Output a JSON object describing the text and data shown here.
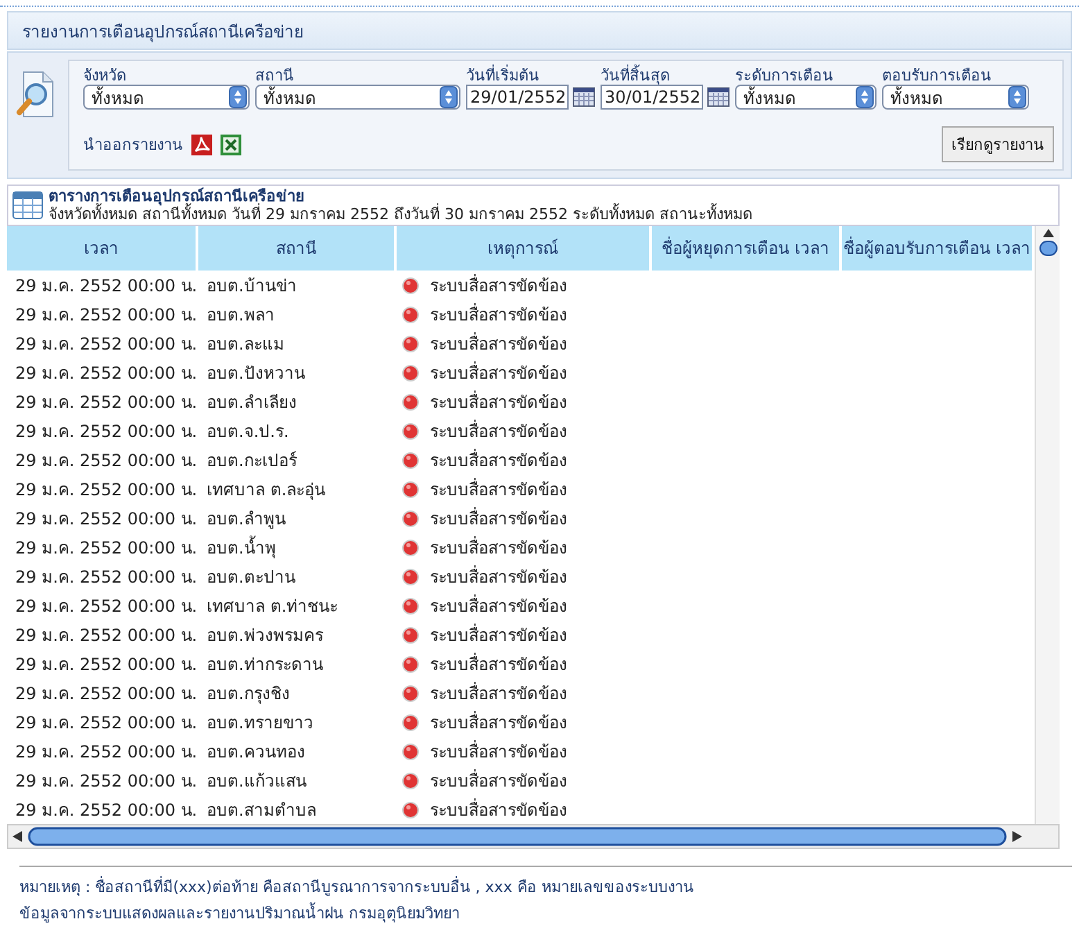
{
  "title": "รายงานการเตือนอุปกรณ์สถานีเครือข่าย",
  "filters": [
    {
      "kind": "select",
      "label": "จังหวัด",
      "value": "ทั้งหมด"
    },
    {
      "kind": "select",
      "label": "สถานี",
      "value": "ทั้งหมด"
    },
    {
      "kind": "date",
      "label": "วันที่เริ่มต้น",
      "value": "29/01/2552"
    },
    {
      "kind": "date",
      "label": "วันที่สิ้นสุด",
      "value": "30/01/2552"
    },
    {
      "kind": "select",
      "label": "ระดับการเตือน",
      "value": "ทั้งหมด"
    },
    {
      "kind": "select",
      "label": "ตอบรับการเตือน",
      "value": "ทั้งหมด"
    }
  ],
  "export_label": "นำออกรายงาน",
  "view_button": "เรียกดูรายงาน",
  "table": {
    "title": "ตารางการเตือนอุปกรณ์สถานีเครือข่าย",
    "subtitle": "จังหวัดทั้งหมด สถานีทั้งหมด วันที่ 29 มกราคม 2552 ถึงวันที่ 30 มกราคม 2552 ระดับทั้งหมด สถานะทั้งหมด",
    "columns": [
      "เวลา",
      "สถานี",
      "เหตุการณ์",
      "ชื่อผู้หยุดการเตือน เวลา",
      "ชื่อผู้ตอบรับการเตือน เวลา"
    ],
    "rows": [
      {
        "time": "29 ม.ค. 2552 00:00 น.",
        "station": "อบต.บ้านข่า",
        "event": "ระบบสื่อสารขัดข้อง"
      },
      {
        "time": "29 ม.ค. 2552 00:00 น.",
        "station": "อบต.พลา",
        "event": "ระบบสื่อสารขัดข้อง"
      },
      {
        "time": "29 ม.ค. 2552 00:00 น.",
        "station": "อบต.ละแม",
        "event": "ระบบสื่อสารขัดข้อง"
      },
      {
        "time": "29 ม.ค. 2552 00:00 น.",
        "station": "อบต.ปังหวาน",
        "event": "ระบบสื่อสารขัดข้อง"
      },
      {
        "time": "29 ม.ค. 2552 00:00 น.",
        "station": "อบต.ลำเลียง",
        "event": "ระบบสื่อสารขัดข้อง"
      },
      {
        "time": "29 ม.ค. 2552 00:00 น.",
        "station": "อบต.จ.ป.ร.",
        "event": "ระบบสื่อสารขัดข้อง"
      },
      {
        "time": "29 ม.ค. 2552 00:00 น.",
        "station": "อบต.กะเปอร์",
        "event": "ระบบสื่อสารขัดข้อง"
      },
      {
        "time": "29 ม.ค. 2552 00:00 น.",
        "station": "เทศบาล ต.ละอุ่น",
        "event": "ระบบสื่อสารขัดข้อง"
      },
      {
        "time": "29 ม.ค. 2552 00:00 น.",
        "station": "อบต.ลำพูน",
        "event": "ระบบสื่อสารขัดข้อง"
      },
      {
        "time": "29 ม.ค. 2552 00:00 น.",
        "station": "อบต.น้ำพุ",
        "event": "ระบบสื่อสารขัดข้อง"
      },
      {
        "time": "29 ม.ค. 2552 00:00 น.",
        "station": "อบต.ตะปาน",
        "event": "ระบบสื่อสารขัดข้อง"
      },
      {
        "time": "29 ม.ค. 2552 00:00 น.",
        "station": "เทศบาล ต.ท่าชนะ",
        "event": "ระบบสื่อสารขัดข้อง"
      },
      {
        "time": "29 ม.ค. 2552 00:00 น.",
        "station": "อบต.พ่วงพรมคร",
        "event": "ระบบสื่อสารขัดข้อง"
      },
      {
        "time": "29 ม.ค. 2552 00:00 น.",
        "station": "อบต.ท่ากระดาน",
        "event": "ระบบสื่อสารขัดข้อง"
      },
      {
        "time": "29 ม.ค. 2552 00:00 น.",
        "station": "อบต.กรุงชิง",
        "event": "ระบบสื่อสารขัดข้อง"
      },
      {
        "time": "29 ม.ค. 2552 00:00 น.",
        "station": "อบต.ทรายขาว",
        "event": "ระบบสื่อสารขัดข้อง"
      },
      {
        "time": "29 ม.ค. 2552 00:00 น.",
        "station": "อบต.ควนทอง",
        "event": "ระบบสื่อสารขัดข้อง"
      },
      {
        "time": "29 ม.ค. 2552 00:00 น.",
        "station": "อบต.แก้วแสน",
        "event": "ระบบสื่อสารขัดข้อง"
      },
      {
        "time": "29 ม.ค. 2552 00:00 น.",
        "station": "อบต.สามตำบล",
        "event": "ระบบสื่อสารขัดข้อง"
      }
    ]
  },
  "notes": [
    "หมายเหตุ : ชื่อสถานีที่มี(xxx)ต่อท้าย คือสถานีบูรณาการจากระบบอื่น , xxx คือ หมายเลขของระบบงาน",
    "ข้อมูลจากระบบแสดงผลและรายงานปริมาณน้ำฝน กรมอุตุนิยมวิทยา"
  ]
}
